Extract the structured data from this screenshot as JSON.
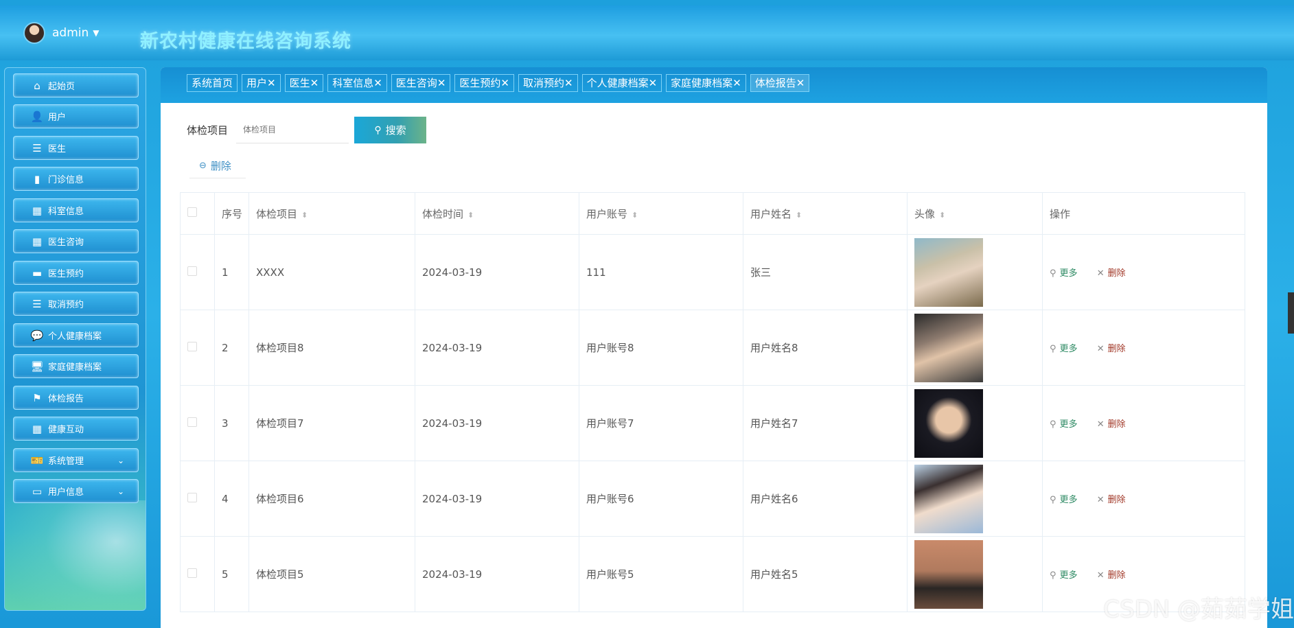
{
  "header": {
    "user": "admin",
    "title": "新农村健康在线咨询系统"
  },
  "sidebar": {
    "items": [
      {
        "label": "起始页",
        "icon": "home-icon"
      },
      {
        "label": "用户",
        "icon": "user-icon"
      },
      {
        "label": "医生",
        "icon": "list-icon"
      },
      {
        "label": "门诊信息",
        "icon": "bar-chart-icon"
      },
      {
        "label": "科室信息",
        "icon": "grid-icon"
      },
      {
        "label": "医生咨询",
        "icon": "grid-icon"
      },
      {
        "label": "医生预约",
        "icon": "monitor-icon"
      },
      {
        "label": "取消预约",
        "icon": "list-icon"
      },
      {
        "label": "个人健康档案",
        "icon": "chat-icon"
      },
      {
        "label": "家庭健康档案",
        "icon": "desktop-icon"
      },
      {
        "label": "体检报告",
        "icon": "flag-icon"
      },
      {
        "label": "健康互动",
        "icon": "grid-icon"
      },
      {
        "label": "系统管理",
        "icon": "ticket-icon"
      },
      {
        "label": "用户信息",
        "icon": "card-icon"
      }
    ]
  },
  "tabs": [
    "系统首页",
    "用户",
    "医生",
    "科室信息",
    "医生咨询",
    "医生预约",
    "取消预约",
    "个人健康档案",
    "家庭健康档案",
    "体检报告"
  ],
  "search": {
    "label": "体检项目",
    "placeholder": "体检项目",
    "button": "搜索"
  },
  "delete_button": "删除",
  "table": {
    "headers": [
      "序号",
      "体检项目",
      "体检时间",
      "用户账号",
      "用户姓名",
      "头像",
      "操作"
    ],
    "rows": [
      {
        "no": "1",
        "item": "XXXX",
        "time": "2024-03-19",
        "account": "111",
        "name": "张三"
      },
      {
        "no": "2",
        "item": "体检项目8",
        "time": "2024-03-19",
        "account": "用户账号8",
        "name": "用户姓名8"
      },
      {
        "no": "3",
        "item": "体检项目7",
        "time": "2024-03-19",
        "account": "用户账号7",
        "name": "用户姓名7"
      },
      {
        "no": "4",
        "item": "体检项目6",
        "time": "2024-03-19",
        "account": "用户账号6",
        "name": "用户姓名6"
      },
      {
        "no": "5",
        "item": "体检项目5",
        "time": "2024-03-19",
        "account": "用户账号5",
        "name": "用户姓名5"
      }
    ],
    "op_more": "更多",
    "op_delete": "删除"
  },
  "watermark": "CSDN @茹茹学姐"
}
